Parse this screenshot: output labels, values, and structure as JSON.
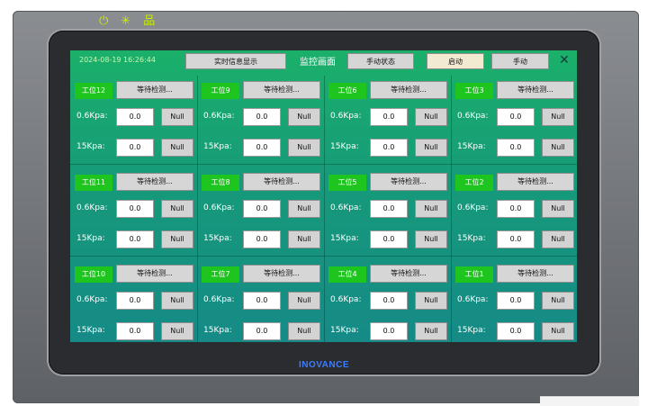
{
  "status_icons": [
    {
      "name": "power-icon",
      "glyph": "⏻"
    },
    {
      "name": "sun-icon",
      "glyph": "✳"
    },
    {
      "name": "network-icon",
      "glyph": "品"
    }
  ],
  "brand": "INOVANCE",
  "topbar": {
    "datetime": "2024-08-19 16:26:44",
    "realtime_label": "实时信息显示",
    "title": "监控画面",
    "manual_status_label": "手动状态",
    "start_label": "启动",
    "manual_label": "手动",
    "close_glyph": "✕"
  },
  "stations": [
    {
      "tag": "工位12",
      "status": "等待检测...",
      "row1_label": "0.6Kpa:",
      "row1_value": "0.0",
      "row1_btn": "Null",
      "row2_label": "15Kpa:",
      "row2_value": "0.0",
      "row2_btn": "Null"
    },
    {
      "tag": "工位9",
      "status": "等待检测...",
      "row1_label": "0.6Kpa:",
      "row1_value": "0.0",
      "row1_btn": "Null",
      "row2_label": "15Kpa:",
      "row2_value": "0.0",
      "row2_btn": "Null"
    },
    {
      "tag": "工位6",
      "status": "等待检测...",
      "row1_label": "0.6Kpa:",
      "row1_value": "0.0",
      "row1_btn": "Null",
      "row2_label": "15Kpa:",
      "row2_value": "0.0",
      "row2_btn": "Null"
    },
    {
      "tag": "工位3",
      "status": "等待检测...",
      "row1_label": "0.6Kpa:",
      "row1_value": "0.0",
      "row1_btn": "Null",
      "row2_label": "15Kpa:",
      "row2_value": "0.0",
      "row2_btn": "Null"
    },
    {
      "tag": "工位11",
      "status": "等待检测...",
      "row1_label": "0.6Kpa:",
      "row1_value": "0.0",
      "row1_btn": "Null",
      "row2_label": "15Kpa:",
      "row2_value": "0.0",
      "row2_btn": "Null"
    },
    {
      "tag": "工位8",
      "status": "等待检测...",
      "row1_label": "0.6Kpa:",
      "row1_value": "0.0",
      "row1_btn": "Null",
      "row2_label": "15Kpa:",
      "row2_value": "0.0",
      "row2_btn": "Null"
    },
    {
      "tag": "工位5",
      "status": "等待检测...",
      "row1_label": "0.6Kpa:",
      "row1_value": "0.0",
      "row1_btn": "Null",
      "row2_label": "15Kpa:",
      "row2_value": "0.0",
      "row2_btn": "Null"
    },
    {
      "tag": "工位2",
      "status": "等待检测...",
      "row1_label": "0.6Kpa:",
      "row1_value": "0.0",
      "row1_btn": "Null",
      "row2_label": "15Kpa:",
      "row2_value": "0.0",
      "row2_btn": "Null"
    },
    {
      "tag": "工位10",
      "status": "等待检测...",
      "row1_label": "0.6Kpa:",
      "row1_value": "0.0",
      "row1_btn": "Null",
      "row2_label": "15Kpa:",
      "row2_value": "0.0",
      "row2_btn": "Null"
    },
    {
      "tag": "工位7",
      "status": "等待检测...",
      "row1_label": "0.6Kpa:",
      "row1_value": "0.0",
      "row1_btn": "Null",
      "row2_label": "15Kpa:",
      "row2_value": "0.0",
      "row2_btn": "Null"
    },
    {
      "tag": "工位4",
      "status": "等待检测...",
      "row1_label": "0.6Kpa:",
      "row1_value": "0.0",
      "row1_btn": "Null",
      "row2_label": "15Kpa:",
      "row2_value": "0.0",
      "row2_btn": "Null"
    },
    {
      "tag": "工位1",
      "status": "等待检测...",
      "row1_label": "0.6Kpa:",
      "row1_value": "0.0",
      "row1_btn": "Null",
      "row2_label": "15Kpa:",
      "row2_value": "0.0",
      "row2_btn": "Null"
    }
  ],
  "colors": {
    "tag_green": "#1fc51f",
    "screen_top": "#1bb06a",
    "screen_bottom": "#158a86",
    "brand_blue": "#3e7cff",
    "status_icon": "#c8f000"
  }
}
